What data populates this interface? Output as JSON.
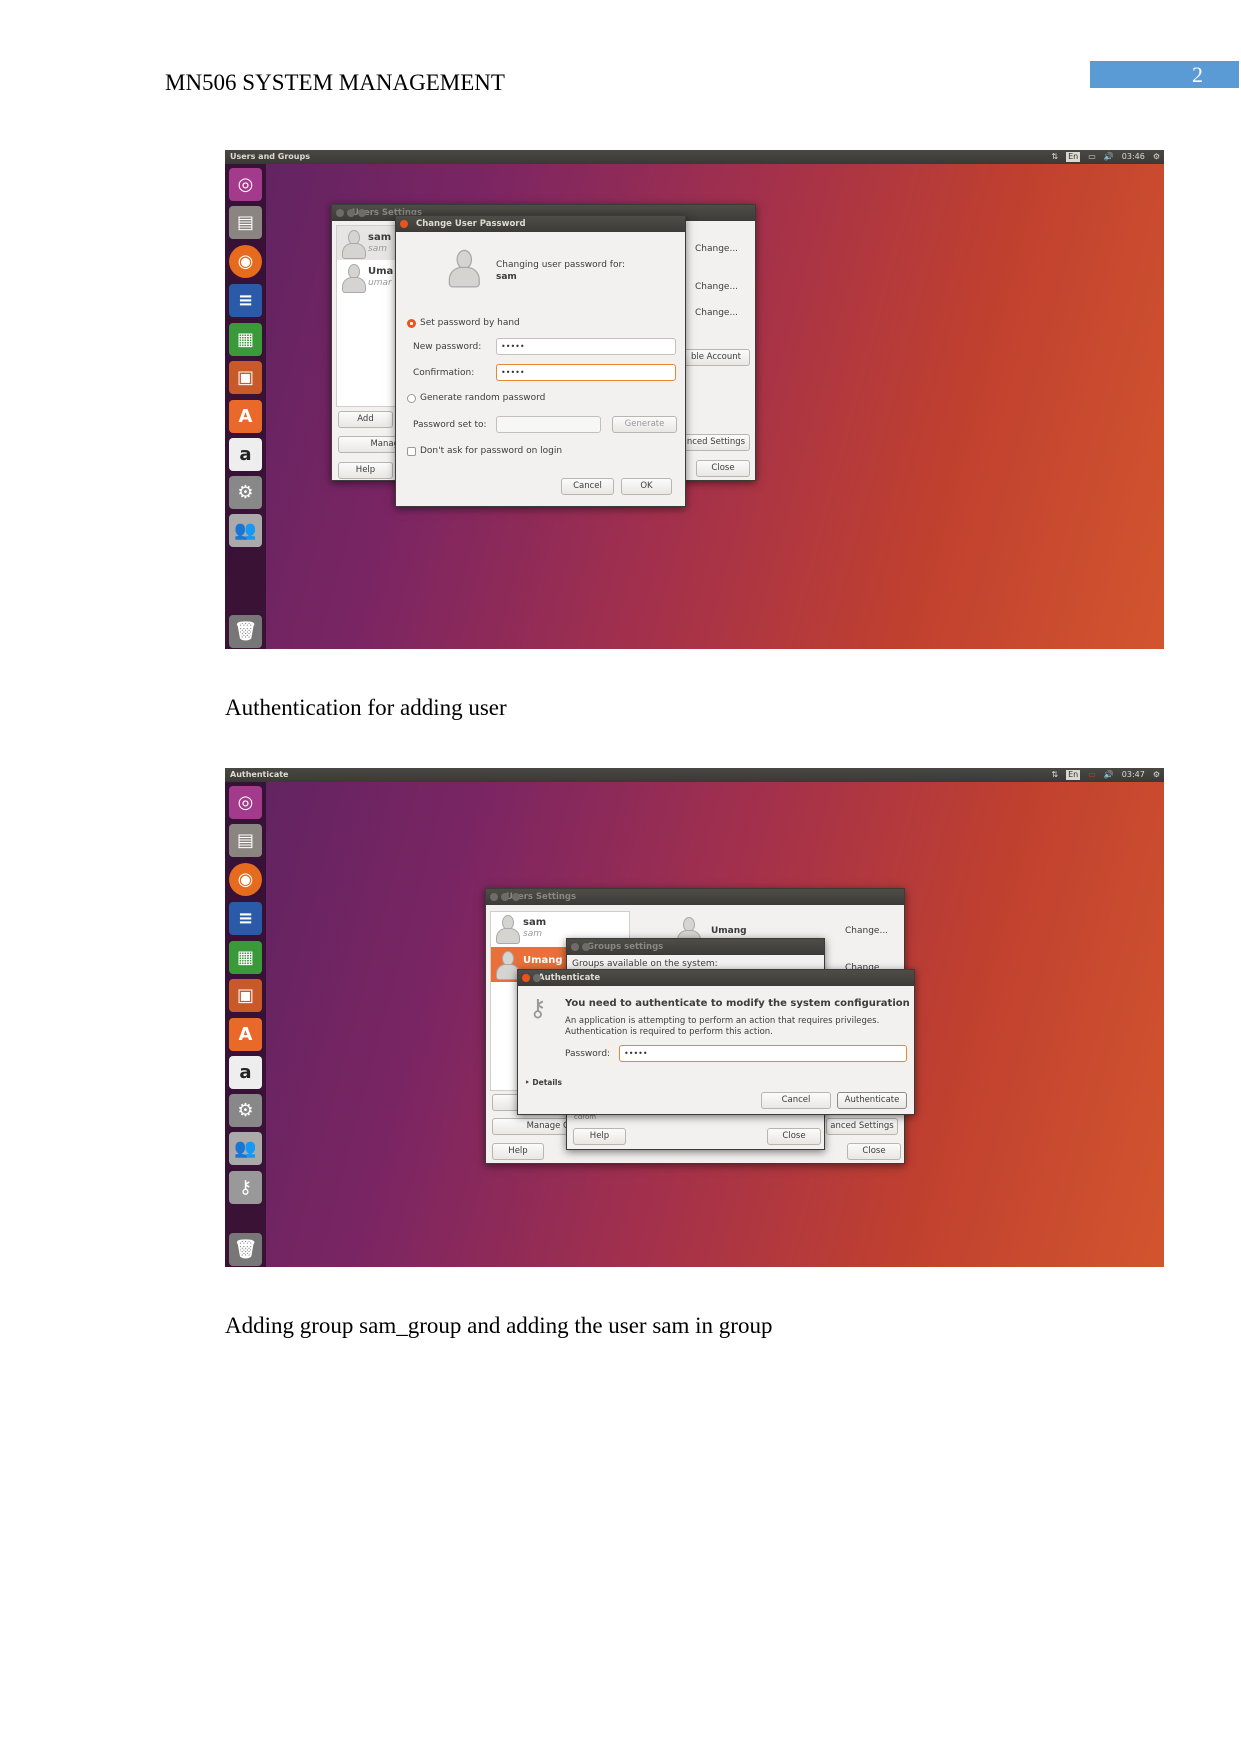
{
  "header": {
    "title": "MN506 SYSTEM MANAGEMENT",
    "page_number": "2"
  },
  "colors": {
    "accent": "#5b9bd5",
    "ubuntu_orange": "#e9541e"
  },
  "captions": [
    "Authentication for adding user",
    "Adding group sam_group and adding the user sam in group"
  ],
  "launcher_icons": [
    "ubuntu-dash-icon",
    "files-icon",
    "firefox-icon",
    "writer-icon",
    "calc-icon",
    "impress-icon",
    "software-center-icon",
    "amazon-icon",
    "system-settings-icon",
    "users-icon",
    "passwords-keys-icon",
    "trash-icon"
  ],
  "shot1": {
    "topbar": {
      "title": "Users and Groups",
      "lang": "En",
      "time": "03:46"
    },
    "users_window": {
      "title": "Users Settings",
      "users": [
        {
          "name": "sam",
          "login": "sam"
        },
        {
          "name": "Uma",
          "login": "umar"
        }
      ],
      "change1": "Change...",
      "change2": "Change...",
      "change3": "Change...",
      "disable": "ble Account",
      "add": "Add",
      "manage": "Manag",
      "advanced": "nced Settings",
      "help": "Help",
      "close": "Close"
    },
    "dialog": {
      "title": "Change User Password",
      "changing_for": "Changing user password for:",
      "user": "sam",
      "set_by_hand": "Set password by hand",
      "new_password_label": "New password:",
      "new_password_value": "•••••",
      "confirmation_label": "Confirmation:",
      "confirmation_value": "•••••",
      "generate_random": "Generate random password",
      "password_set_to": "Password set to:",
      "generate": "Generate",
      "dont_ask": "Don't ask for password on login",
      "cancel": "Cancel",
      "ok": "OK"
    }
  },
  "shot2": {
    "topbar": {
      "title": "Authenticate",
      "lang": "En",
      "time": "03:47"
    },
    "users_window": {
      "title": "Users Settings",
      "users": [
        {
          "name": "sam",
          "login": "sam"
        },
        {
          "name": "Umang"
        }
      ],
      "selected_name": "Umang",
      "change1": "Change...",
      "change2": "Change",
      "add": "A",
      "manage": "Manage C",
      "advanced": "anced Settings",
      "help": "Help",
      "close": "Close"
    },
    "groups_window": {
      "title": "Groups settings",
      "available": "Groups available on the system:",
      "partial": "cdrom",
      "help": "Help",
      "close": "Close"
    },
    "auth": {
      "title": "Authenticate",
      "heading": "You need to authenticate to modify the system configuration",
      "desc1": "An application is attempting to perform an action that requires privileges.",
      "desc2": "Authentication is required to perform this action.",
      "password_label": "Password:",
      "password_value": "•••••",
      "details": "Details",
      "cancel": "Cancel",
      "authenticate": "Authenticate"
    }
  }
}
